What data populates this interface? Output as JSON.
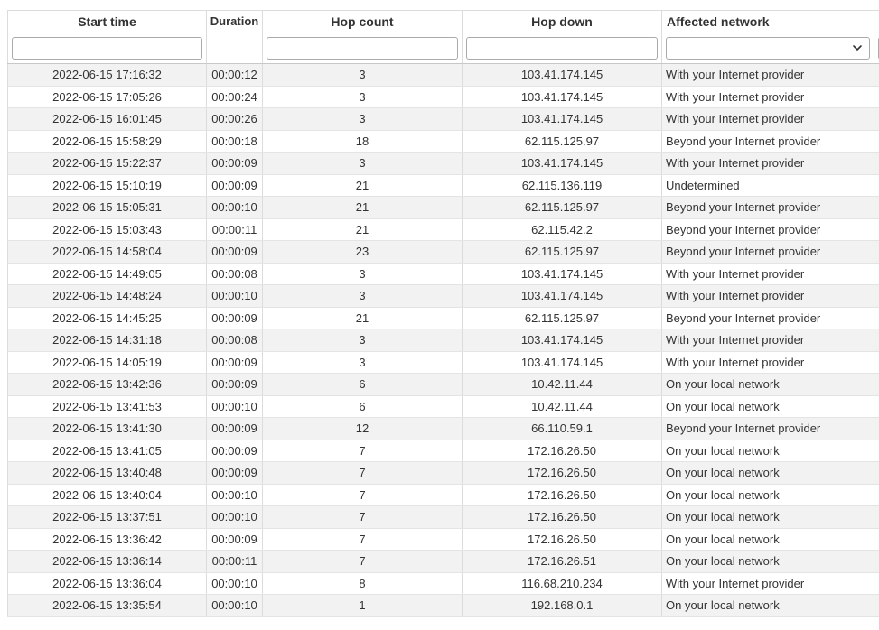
{
  "columns": {
    "start_time": "Start time",
    "duration": "Duration",
    "hop_count": "Hop count",
    "hop_down": "Hop down",
    "affected_network": "Affected network"
  },
  "filters": {
    "start_time": "",
    "hop_count": "",
    "hop_down": "",
    "affected_network_selected": ""
  },
  "rows": [
    {
      "start": "2022-06-15 17:16:32",
      "duration": "00:00:12",
      "hops": "3",
      "hop_down": "103.41.174.145",
      "network": "With your Internet provider"
    },
    {
      "start": "2022-06-15 17:05:26",
      "duration": "00:00:24",
      "hops": "3",
      "hop_down": "103.41.174.145",
      "network": "With your Internet provider"
    },
    {
      "start": "2022-06-15 16:01:45",
      "duration": "00:00:26",
      "hops": "3",
      "hop_down": "103.41.174.145",
      "network": "With your Internet provider"
    },
    {
      "start": "2022-06-15 15:58:29",
      "duration": "00:00:18",
      "hops": "18",
      "hop_down": "62.115.125.97",
      "network": "Beyond your Internet provider"
    },
    {
      "start": "2022-06-15 15:22:37",
      "duration": "00:00:09",
      "hops": "3",
      "hop_down": "103.41.174.145",
      "network": "With your Internet provider"
    },
    {
      "start": "2022-06-15 15:10:19",
      "duration": "00:00:09",
      "hops": "21",
      "hop_down": "62.115.136.119",
      "network": "Undetermined"
    },
    {
      "start": "2022-06-15 15:05:31",
      "duration": "00:00:10",
      "hops": "21",
      "hop_down": "62.115.125.97",
      "network": "Beyond your Internet provider"
    },
    {
      "start": "2022-06-15 15:03:43",
      "duration": "00:00:11",
      "hops": "21",
      "hop_down": "62.115.42.2",
      "network": "Beyond your Internet provider"
    },
    {
      "start": "2022-06-15 14:58:04",
      "duration": "00:00:09",
      "hops": "23",
      "hop_down": "62.115.125.97",
      "network": "Beyond your Internet provider"
    },
    {
      "start": "2022-06-15 14:49:05",
      "duration": "00:00:08",
      "hops": "3",
      "hop_down": "103.41.174.145",
      "network": "With your Internet provider"
    },
    {
      "start": "2022-06-15 14:48:24",
      "duration": "00:00:10",
      "hops": "3",
      "hop_down": "103.41.174.145",
      "network": "With your Internet provider"
    },
    {
      "start": "2022-06-15 14:45:25",
      "duration": "00:00:09",
      "hops": "21",
      "hop_down": "62.115.125.97",
      "network": "Beyond your Internet provider"
    },
    {
      "start": "2022-06-15 14:31:18",
      "duration": "00:00:08",
      "hops": "3",
      "hop_down": "103.41.174.145",
      "network": "With your Internet provider"
    },
    {
      "start": "2022-06-15 14:05:19",
      "duration": "00:00:09",
      "hops": "3",
      "hop_down": "103.41.174.145",
      "network": "With your Internet provider"
    },
    {
      "start": "2022-06-15 13:42:36",
      "duration": "00:00:09",
      "hops": "6",
      "hop_down": "10.42.11.44",
      "network": "On your local network"
    },
    {
      "start": "2022-06-15 13:41:53",
      "duration": "00:00:10",
      "hops": "6",
      "hop_down": "10.42.11.44",
      "network": "On your local network"
    },
    {
      "start": "2022-06-15 13:41:30",
      "duration": "00:00:09",
      "hops": "12",
      "hop_down": "66.110.59.1",
      "network": "Beyond your Internet provider"
    },
    {
      "start": "2022-06-15 13:41:05",
      "duration": "00:00:09",
      "hops": "7",
      "hop_down": "172.16.26.50",
      "network": "On your local network"
    },
    {
      "start": "2022-06-15 13:40:48",
      "duration": "00:00:09",
      "hops": "7",
      "hop_down": "172.16.26.50",
      "network": "On your local network"
    },
    {
      "start": "2022-06-15 13:40:04",
      "duration": "00:00:10",
      "hops": "7",
      "hop_down": "172.16.26.50",
      "network": "On your local network"
    },
    {
      "start": "2022-06-15 13:37:51",
      "duration": "00:00:10",
      "hops": "7",
      "hop_down": "172.16.26.50",
      "network": "On your local network"
    },
    {
      "start": "2022-06-15 13:36:42",
      "duration": "00:00:09",
      "hops": "7",
      "hop_down": "172.16.26.50",
      "network": "On your local network"
    },
    {
      "start": "2022-06-15 13:36:14",
      "duration": "00:00:11",
      "hops": "7",
      "hop_down": "172.16.26.51",
      "network": "On your local network"
    },
    {
      "start": "2022-06-15 13:36:04",
      "duration": "00:00:10",
      "hops": "8",
      "hop_down": "116.68.210.234",
      "network": "With your Internet provider"
    },
    {
      "start": "2022-06-15 13:35:54",
      "duration": "00:00:10",
      "hops": "1",
      "hop_down": "192.168.0.1",
      "network": "On your local network"
    }
  ],
  "icons": {
    "select_chevron": "chevron-down-icon"
  }
}
